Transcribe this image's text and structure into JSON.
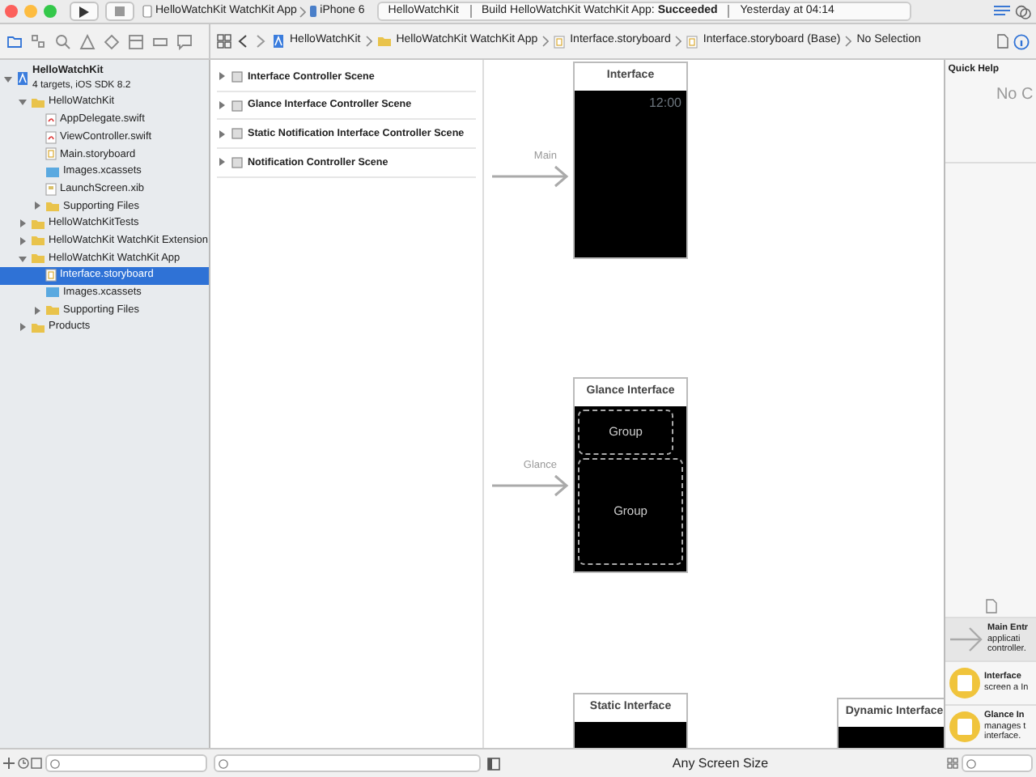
{
  "toolbar": {
    "scheme": "HelloWatchKit WatchKit App",
    "device": "iPhone 6",
    "status": {
      "project": "HelloWatchKit",
      "message": "Build HelloWatchKit WatchKit App: **Succeeded**",
      "time": "Yesterday at 04:14"
    }
  },
  "navigator_tabs": [
    {
      "selected": true
    },
    {
      "selected": false
    },
    {
      "selected": false
    },
    {
      "selected": false
    },
    {
      "selected": false
    },
    {
      "selected": false
    },
    {
      "selected": false
    },
    {
      "selected": false
    }
  ],
  "jump_bar": {
    "path": [
      {
        "label": "HelloWatchKit",
        "kind": "project"
      },
      {
        "label": "HelloWatchKit WatchKit App",
        "kind": "folder"
      },
      {
        "label": "Interface.storyboard",
        "kind": "storyboard"
      },
      {
        "label": "Interface.storyboard (Base)",
        "kind": "storyboard"
      },
      {
        "label": "No Selection",
        "kind": "text"
      }
    ]
  },
  "tree": [
    {
      "name": "HelloWatchKit",
      "subtitle": "4 targets, iOS SDK 8.2",
      "kind": "project",
      "expanded": true,
      "selected": false,
      "children": [
        {
          "name": "HelloWatchKit",
          "kind": "folder",
          "expanded": true,
          "selected": false,
          "children": [
            {
              "name": "AppDelegate.swift",
              "kind": "swift",
              "selected": false
            },
            {
              "name": "ViewController.swift",
              "kind": "swift",
              "selected": false
            },
            {
              "name": "Main.storyboard",
              "kind": "storyboard",
              "selected": false
            },
            {
              "name": "Images.xcassets",
              "kind": "assets",
              "selected": false
            },
            {
              "name": "LaunchScreen.xib",
              "kind": "xib",
              "selected": false
            },
            {
              "name": "Supporting Files",
              "kind": "folder",
              "expanded": false,
              "selected": false
            }
          ]
        },
        {
          "name": "HelloWatchKitTests",
          "kind": "folder",
          "expanded": false,
          "selected": false
        },
        {
          "name": "HelloWatchKit WatchKit Extension",
          "kind": "folder",
          "expanded": false,
          "selected": false
        },
        {
          "name": "HelloWatchKit WatchKit App",
          "kind": "folder",
          "expanded": true,
          "selected": false,
          "children": [
            {
              "name": "Interface.storyboard",
              "kind": "storyboard",
              "selected": true
            },
            {
              "name": "Images.xcassets",
              "kind": "assets",
              "selected": false
            },
            {
              "name": "Supporting Files",
              "kind": "folder",
              "expanded": false,
              "selected": false
            }
          ]
        },
        {
          "name": "Products",
          "kind": "folder",
          "expanded": false,
          "selected": false
        }
      ]
    }
  ],
  "outline": [
    {
      "label": "Interface Controller Scene",
      "expanded": false
    },
    {
      "label": "Glance Interface Controller Scene",
      "expanded": false
    },
    {
      "label": "Static Notification Interface Controller Scene",
      "expanded": false
    },
    {
      "label": "Notification Controller Scene",
      "expanded": false
    }
  ],
  "canvas": {
    "scenes": [
      {
        "title": "Interface",
        "kind": "main",
        "entry": "Main",
        "time": "12:00"
      },
      {
        "title": "Glance Interface",
        "kind": "glance",
        "entry": "Glance",
        "groups": [
          "Group",
          "Group"
        ]
      },
      {
        "title": "Static Interface",
        "kind": "notification"
      },
      {
        "title": "Dynamic Interface",
        "kind": "notification"
      }
    ],
    "size_class": "Any Screen Size"
  },
  "inspector": {
    "title": "Quick Help",
    "message": "No C"
  },
  "library": [
    {
      "kind": "arrow",
      "title": "Main Entr",
      "lines": [
        "applicati",
        "controller."
      ]
    },
    {
      "kind": "interface",
      "title": "Interface",
      "lines": [
        "screen a In"
      ]
    },
    {
      "kind": "glance",
      "title": "Glance In",
      "lines": [
        "manages t",
        "interface."
      ]
    }
  ]
}
